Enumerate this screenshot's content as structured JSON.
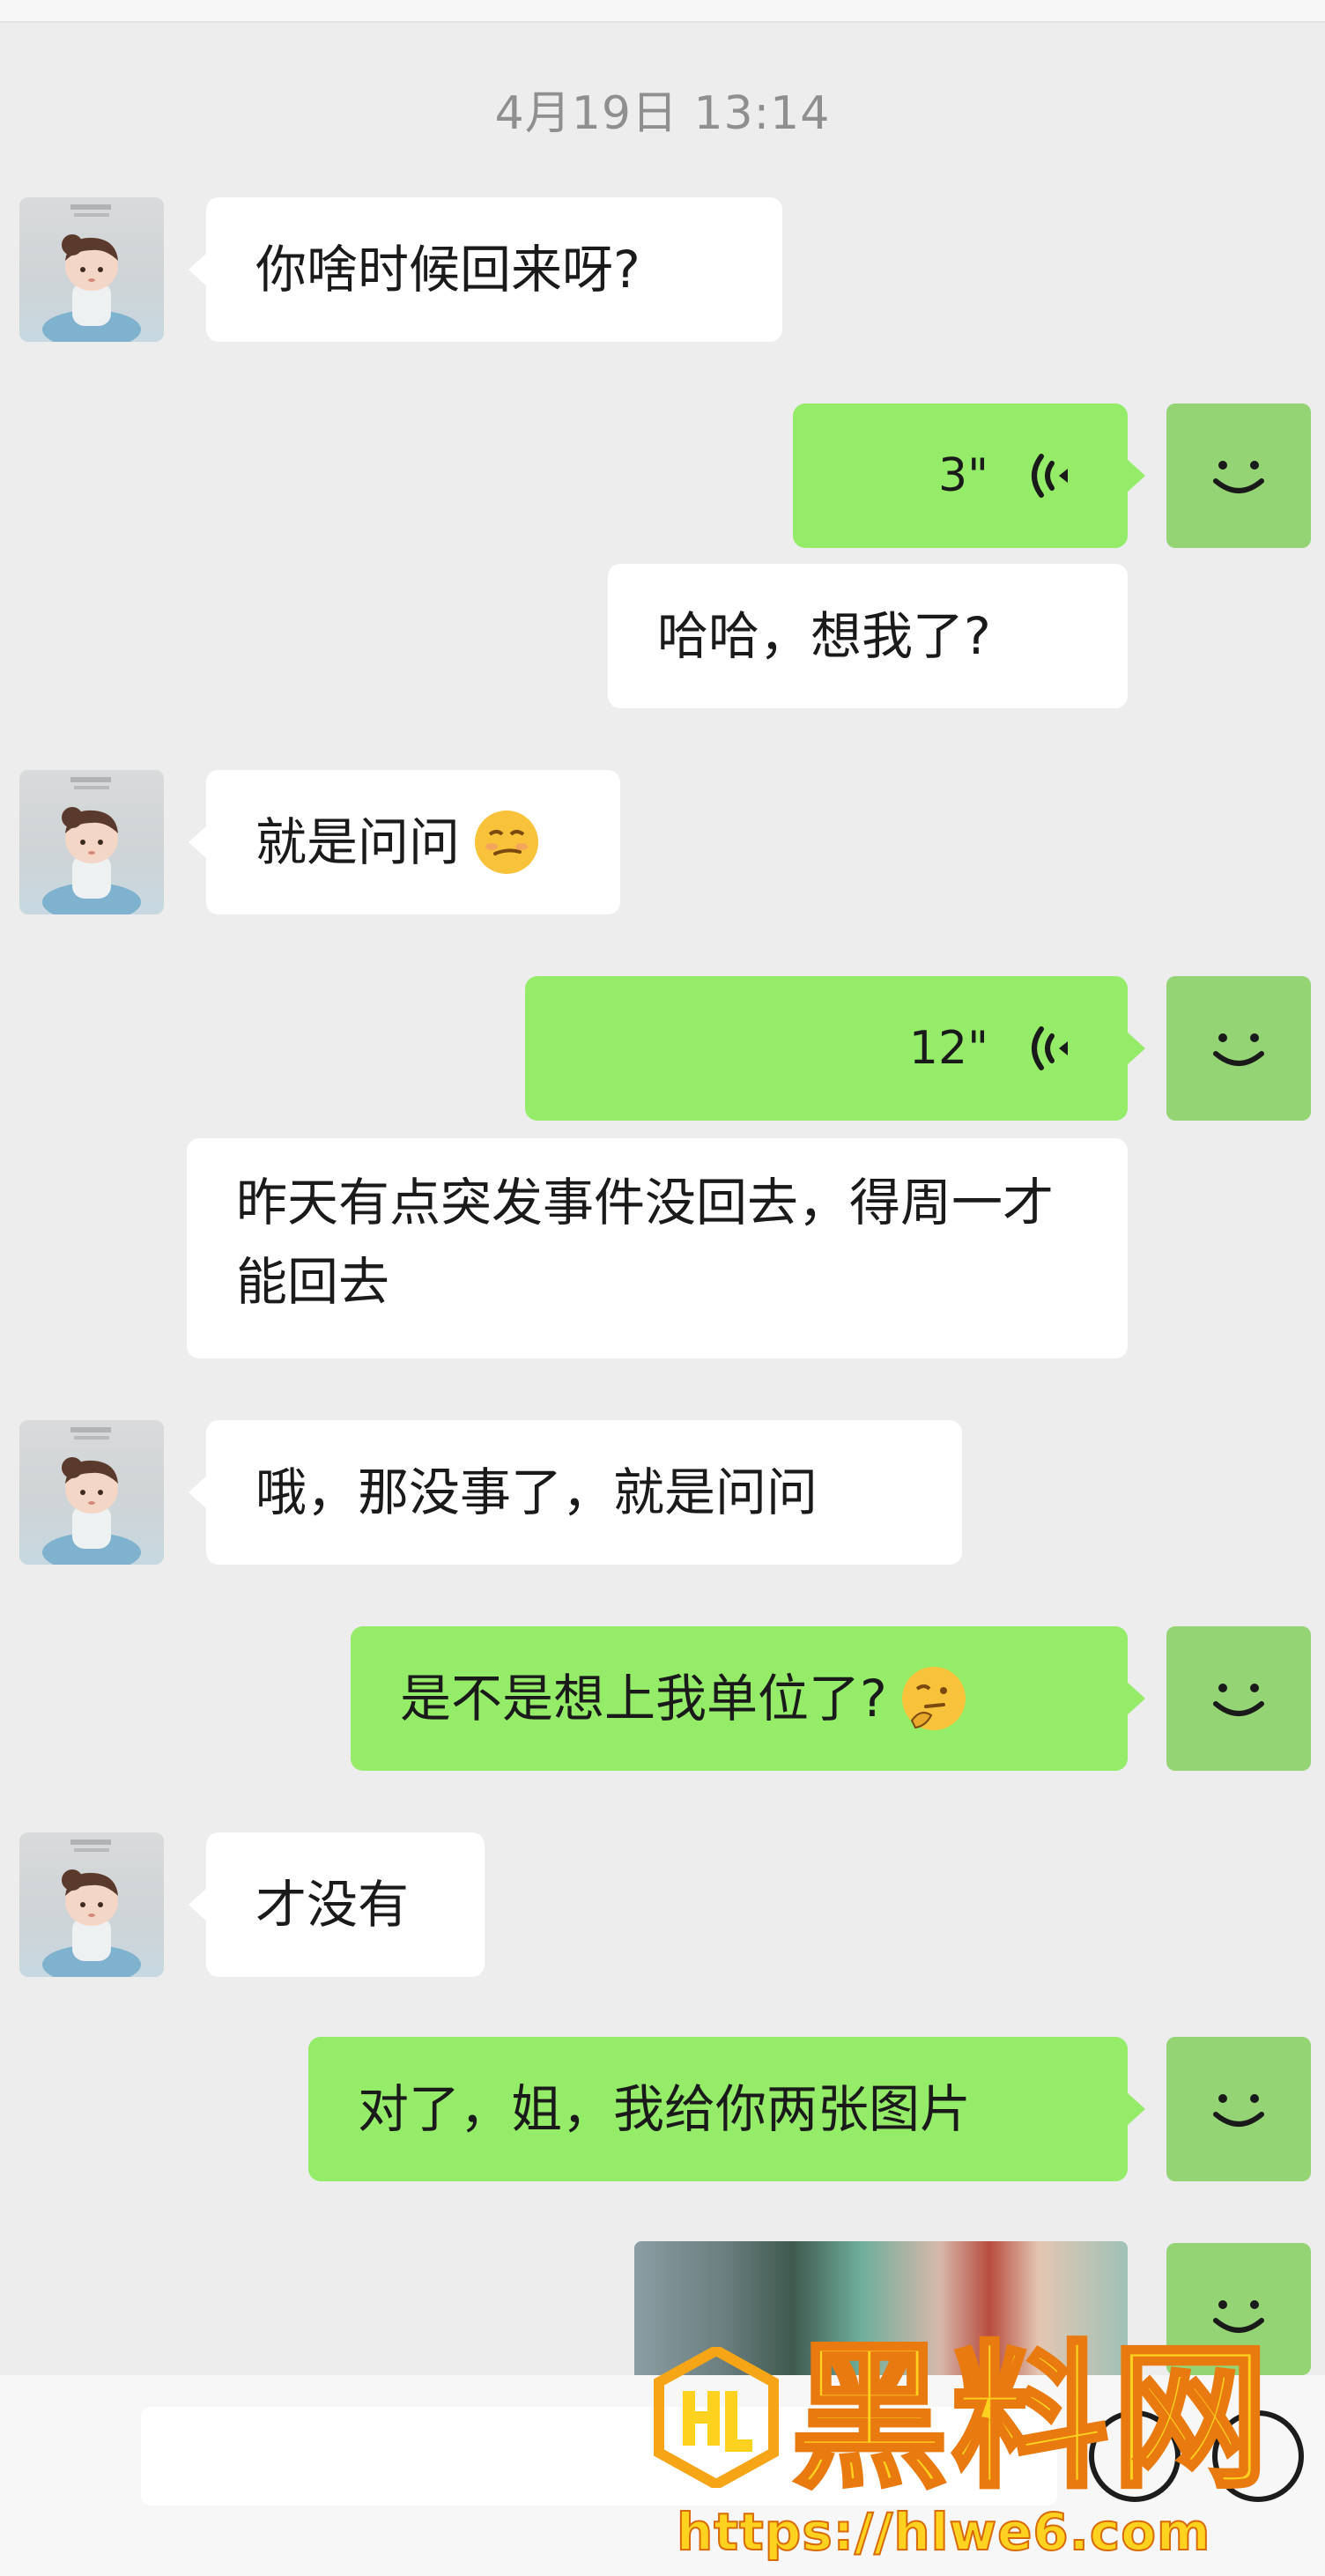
{
  "header": {
    "timestamp": "4月19日 13:14"
  },
  "messages": [
    {
      "from": "contact",
      "text": "你啥时候回来呀?"
    },
    {
      "from": "self",
      "kind": "voice",
      "duration": "3\""
    },
    {
      "from": "self",
      "text": "哈哈，想我了?"
    },
    {
      "from": "contact",
      "text": "就是问问",
      "emoji": "smirk-emoji"
    },
    {
      "from": "self",
      "kind": "voice",
      "duration": "12\""
    },
    {
      "from": "self",
      "text": "昨天有点突发事件没回去，得周一才能回去"
    },
    {
      "from": "contact",
      "text": "哦，那没事了，就是问问"
    },
    {
      "from": "self",
      "text": "是不是想上我单位了?",
      "emoji": "thinking-emoji"
    },
    {
      "from": "contact",
      "text": "才没有"
    },
    {
      "from": "self",
      "text": "对了，姐，我给你两张图片"
    },
    {
      "from": "self",
      "kind": "image"
    }
  ],
  "watermark": {
    "title": "黑料网",
    "url": "https://hlwe6.com"
  },
  "colors": {
    "background": "#ededed",
    "self_bubble": "#95ec69",
    "contact_bubble": "#ffffff",
    "watermark_fill": "#ffd21f",
    "watermark_stroke": "#e87a10"
  },
  "icons": {
    "voice": "voice-wave-icon",
    "emoji_button": "emoji-icon",
    "add_button": "plus-icon"
  }
}
